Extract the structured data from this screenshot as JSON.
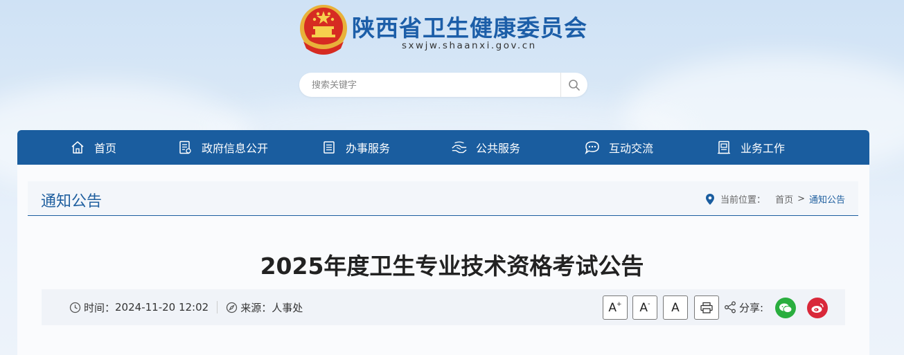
{
  "header": {
    "site_title": "陕西省卫生健康委员会",
    "site_domain": "sxwjw.shaanxi.gov.cn",
    "search_placeholder": "搜索关键字"
  },
  "nav": {
    "items": [
      {
        "label": "首页",
        "icon": "home-icon"
      },
      {
        "label": "政府信息公开",
        "icon": "document-icon"
      },
      {
        "label": "办事服务",
        "icon": "list-icon"
      },
      {
        "label": "公共服务",
        "icon": "handshake-icon"
      },
      {
        "label": "互动交流",
        "icon": "chat-icon"
      },
      {
        "label": "业务工作",
        "icon": "briefcase-icon"
      }
    ]
  },
  "section": {
    "title": "通知公告",
    "location_label": "当前位置：",
    "crumb_home": "首页",
    "crumb_sep": ">",
    "crumb_current": "通知公告"
  },
  "article": {
    "title": "2025年度卫生专业技术资格考试公告",
    "time_label": "时间：",
    "time_value": "2024-11-20 12:02",
    "source_label": "来源：",
    "source_value": "人事处"
  },
  "tools": {
    "font_large": "A",
    "font_large_sup": "+",
    "font_small": "A",
    "font_small_sup": "-",
    "font_default": "A",
    "share_label": "分享:"
  },
  "colors": {
    "brand": "#1a5d9f",
    "wechat": "#2aae3f",
    "weibo": "#d9283a"
  }
}
